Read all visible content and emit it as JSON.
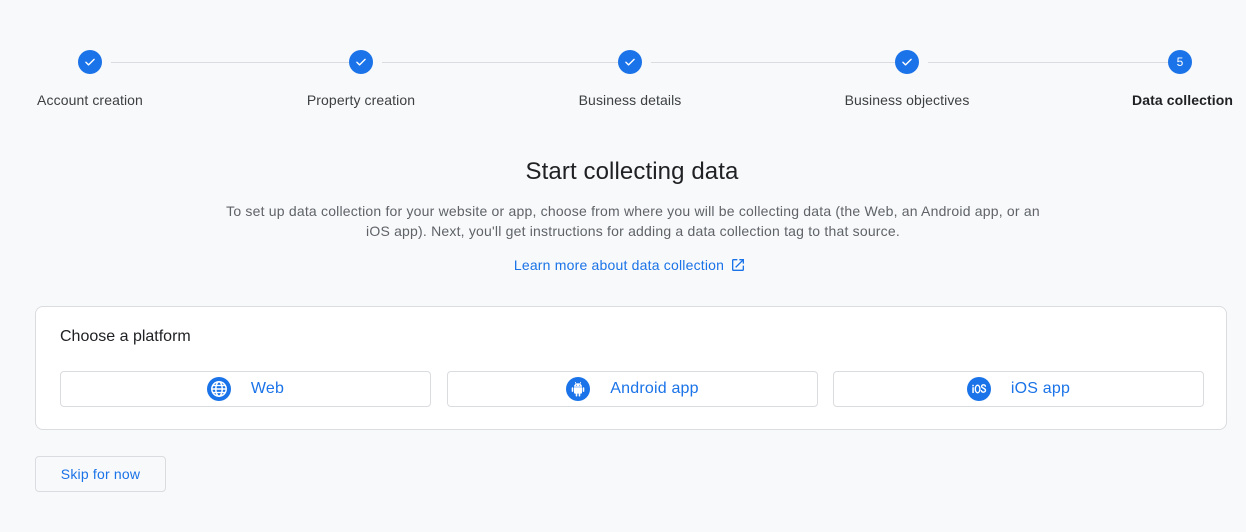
{
  "stepper": {
    "steps": [
      {
        "label": "Account creation",
        "state": "completed"
      },
      {
        "label": "Property creation",
        "state": "completed"
      },
      {
        "label": "Business details",
        "state": "completed"
      },
      {
        "label": "Business objectives",
        "state": "completed"
      },
      {
        "label": "Data collection",
        "state": "current",
        "number": "5"
      }
    ],
    "completed_icon": "check-icon"
  },
  "header": {
    "title": "Start collecting data",
    "description": "To set up data collection for your website or app, choose from where you will be collecting data (the Web, an Android app, or an iOS app). Next, you'll get instructions for adding a data collection tag to that source.",
    "learn_more": "Learn more about data collection",
    "learn_more_icon": "external-link-icon"
  },
  "platform_card": {
    "title": "Choose a platform",
    "options": [
      {
        "label": "Web",
        "icon": "globe-icon"
      },
      {
        "label": "Android app",
        "icon": "android-icon"
      },
      {
        "label": "iOS app",
        "icon": "ios-icon"
      }
    ]
  },
  "footer": {
    "skip_label": "Skip for now"
  },
  "colors": {
    "accent": "#1a73e8",
    "background": "#f8f9fa",
    "border": "#dadce0",
    "text_primary": "#202124",
    "text_secondary": "#5f6368"
  }
}
